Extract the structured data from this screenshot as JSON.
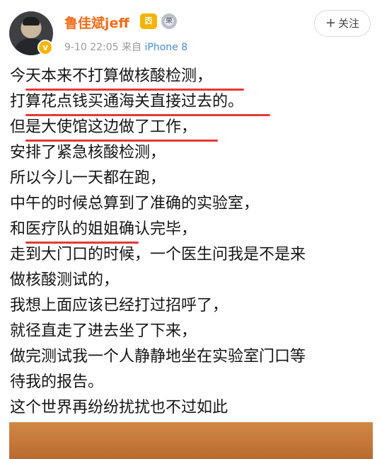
{
  "header": {
    "username": "鲁佳斌jeff",
    "badge_gold": "㐁",
    "badge_silver": "荣",
    "date": "9-10 22:05",
    "from_label": "来自",
    "device": "iPhone 8",
    "follow_label": "关注",
    "follow_icon": "plus-icon",
    "verified_icon": "v"
  },
  "post": {
    "lines": [
      "今天本来不打算做核酸检测，",
      "打算花点钱买通海关直接过去的。",
      "但是大使馆这边做了工作，",
      "安排了紧急核酸检测，",
      "所以今儿一天都在跑，",
      "中午的时候总算到了准确的实验室，",
      "和医疗队的姐姐确认完毕，",
      "走到大门口的时候，一个医生问我是不是来",
      "做核酸测试的，",
      "我想上面应该已经打过招呼了，",
      "就径直走了进去坐了下来，",
      "做完测试我一个人静静地坐在实验室门口等",
      "待我的报告。",
      "这个世界再纷纷扰扰也不过如此"
    ]
  },
  "colors": {
    "username": "#f26d1b",
    "device": "#4a8bd1",
    "highlight": "#e53935",
    "text": "#151515"
  }
}
